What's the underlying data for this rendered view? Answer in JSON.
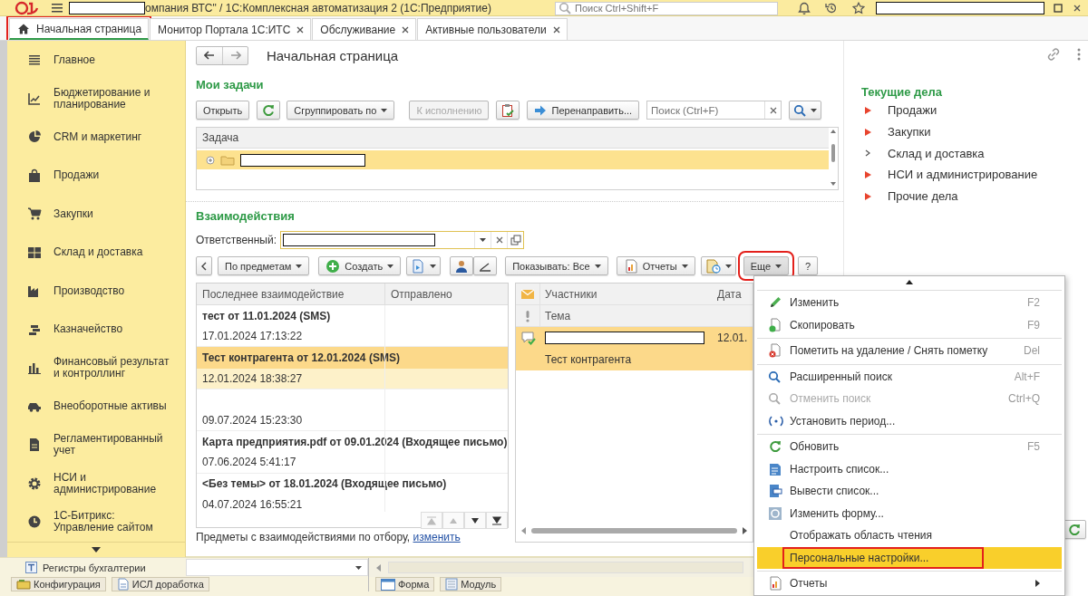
{
  "top_bar": {
    "title": "омпания ВТС\" / 1С:Комплексная автоматизация 2 (1С:Предприятие)",
    "search": {
      "placeholder": "Поиск Ctrl+Shift+F"
    }
  },
  "tabs": [
    {
      "label": "Начальная страница",
      "selected": true,
      "closable": false,
      "highlighted": true
    },
    {
      "label": "Монитор Портала 1С:ИТС",
      "selected": false,
      "closable": true,
      "highlighted": false
    },
    {
      "label": "Обслуживание",
      "selected": false,
      "closable": true,
      "highlighted": false
    },
    {
      "label": "Активные пользователи",
      "selected": false,
      "closable": true,
      "highlighted": false
    }
  ],
  "sidebar": {
    "items": [
      {
        "label": "Главное"
      },
      {
        "label": "Бюджетирование и планирование"
      },
      {
        "label": "CRM и маркетинг"
      },
      {
        "label": "Продажи"
      },
      {
        "label": "Закупки"
      },
      {
        "label": "Склад и доставка"
      },
      {
        "label": "Производство"
      },
      {
        "label": "Казначейство"
      },
      {
        "label": "Финансовый результат и контроллинг"
      },
      {
        "label": "Внеоборотные активы"
      },
      {
        "label": "Регламентированный учет"
      },
      {
        "label": "НСИ и администрирование"
      },
      {
        "label": "1С-Битрикс: Управление сайтом"
      }
    ]
  },
  "page": {
    "title": "Начальная страница"
  },
  "my_tasks": {
    "heading": "Мои задачи",
    "toolbar": [
      {
        "kind": "button",
        "label": "Открыть",
        "dropdown": false,
        "disabled": false
      },
      {
        "kind": "icon",
        "dropdown": false,
        "disabled": false
      },
      {
        "kind": "button",
        "label": "Сгруппировать по",
        "dropdown": true,
        "disabled": false
      },
      {
        "kind": "button",
        "label": "К исполнению",
        "dropdown": false,
        "disabled": true
      },
      {
        "kind": "icon",
        "dropdown": false,
        "disabled": false
      },
      {
        "kind": "button",
        "label": "Перенаправить...",
        "dropdown": false,
        "disabled": false
      },
      {
        "kind": "search",
        "placeholder": "Поиск (Ctrl+F)"
      },
      {
        "kind": "icon",
        "dropdown": true,
        "disabled": false
      }
    ],
    "table": {
      "columns": [
        "Задача"
      ],
      "rows": [
        {
          "selected": true
        }
      ]
    }
  },
  "interactions": {
    "heading": "Взаимодействия",
    "responsible": {
      "label": "Ответственный:"
    },
    "toolbar": [
      {
        "kind": "icon",
        "dropdown": false,
        "disabled": false,
        "highlighted": false
      },
      {
        "kind": "button",
        "label": "По предметам",
        "dropdown": true,
        "disabled": false,
        "highlighted": false
      },
      {
        "kind": "button",
        "label": "Создать",
        "dropdown": true,
        "disabled": false,
        "highlighted": false
      },
      {
        "kind": "icon",
        "dropdown": true,
        "disabled": false,
        "highlighted": false
      },
      {
        "kind": "icon",
        "dropdown": false,
        "disabled": false,
        "highlighted": false
      },
      {
        "kind": "icon",
        "dropdown": false,
        "disabled": false,
        "highlighted": false
      },
      {
        "kind": "button",
        "label": "Показывать: Все",
        "dropdown": true,
        "disabled": false,
        "highlighted": false
      },
      {
        "kind": "button",
        "label": "Отчеты",
        "dropdown": true,
        "disabled": false,
        "highlighted": false
      },
      {
        "kind": "icon",
        "dropdown": true,
        "disabled": false,
        "highlighted": false
      },
      {
        "kind": "button",
        "label": "Еще",
        "dropdown": true,
        "disabled": false,
        "highlighted": true
      },
      {
        "kind": "button",
        "label": "?",
        "dropdown": false,
        "disabled": false,
        "highlighted": false
      }
    ],
    "list": {
      "columns": [
        "Последнее взаимодействие",
        "Отправлено"
      ],
      "rows": [
        {
          "subject": "тест от 11.01.2024 (SMS)",
          "date": "17.01.2024 17:13:22",
          "selected": false
        },
        {
          "subject": "Тест контрагента от 12.01.2024 (SMS)",
          "date": "12.01.2024 18:38:27",
          "selected": true
        },
        {
          "date": "09.07.2024 15:23:30",
          "selected": false
        },
        {
          "subject": "Карта предприятия.pdf от 09.01.2024 (Входящее письмо)",
          "date": "07.06.2024 5:41:17",
          "selected": false
        },
        {
          "subject": "<Без темы> от 18.01.2024 (Входящее письмо)",
          "date": "04.07.2024 16:55:21",
          "selected": false
        }
      ],
      "navigation": [
        {
          "disabled": true
        },
        {
          "disabled": true
        },
        {
          "disabled": false
        },
        {
          "disabled": false
        }
      ]
    },
    "detail": {
      "columns": [
        "Участники",
        "Дата"
      ],
      "subcolumn": "Тема",
      "rows": [
        {
          "date": "12.01.",
          "subject": "Тест контрагента",
          "selected": true
        }
      ]
    },
    "footer": {
      "text": "Предметы с взаимодействиями по отбору,",
      "link": "изменить"
    }
  },
  "current_tasks": {
    "heading": "Текущие дела",
    "items": [
      {
        "label": "Продажи",
        "attention": true
      },
      {
        "label": "Закупки",
        "attention": true
      },
      {
        "label": "Склад и доставка",
        "attention": false
      },
      {
        "label": "НСИ и администрирование",
        "attention": true
      },
      {
        "label": "Прочие дела",
        "attention": true
      }
    ]
  },
  "menu": {
    "items": [
      {
        "kind": "item",
        "label": "Изменить",
        "shortcut": "F2",
        "disabled": false,
        "selected": false,
        "highlighted": false,
        "submenu": false
      },
      {
        "kind": "item",
        "label": "Скопировать",
        "shortcut": "F9",
        "disabled": false,
        "selected": false,
        "highlighted": false,
        "submenu": false
      },
      {
        "kind": "separator"
      },
      {
        "kind": "item",
        "label": "Пометить на удаление / Снять пометку",
        "shortcut": "Del",
        "disabled": false,
        "selected": false,
        "highlighted": false,
        "submenu": false
      },
      {
        "kind": "separator"
      },
      {
        "kind": "item",
        "label": "Расширенный поиск",
        "shortcut": "Alt+F",
        "disabled": false,
        "selected": false,
        "highlighted": false,
        "submenu": false
      },
      {
        "kind": "item",
        "label": "Отменить поиск",
        "shortcut": "Ctrl+Q",
        "disabled": true,
        "selected": false,
        "highlighted": false,
        "submenu": false
      },
      {
        "kind": "item",
        "label": "Установить период...",
        "disabled": false,
        "selected": false,
        "highlighted": false,
        "submenu": false
      },
      {
        "kind": "separator"
      },
      {
        "kind": "item",
        "label": "Обновить",
        "shortcut": "F5",
        "disabled": false,
        "selected": false,
        "highlighted": false,
        "submenu": false
      },
      {
        "kind": "item",
        "label": "Настроить список...",
        "disabled": false,
        "selected": false,
        "highlighted": false,
        "submenu": false
      },
      {
        "kind": "item",
        "label": "Вывести список...",
        "disabled": false,
        "selected": false,
        "highlighted": false,
        "submenu": false
      },
      {
        "kind": "item",
        "label": "Изменить форму...",
        "disabled": false,
        "selected": false,
        "highlighted": false,
        "submenu": false
      },
      {
        "kind": "item",
        "label": "Отображать область чтения",
        "disabled": false,
        "selected": false,
        "highlighted": false,
        "submenu": false
      },
      {
        "kind": "item",
        "label": "Персональные настройки...",
        "disabled": false,
        "selected": true,
        "highlighted": true,
        "submenu": false
      },
      {
        "kind": "separator"
      },
      {
        "kind": "item",
        "label": "Отчеты",
        "disabled": false,
        "selected": false,
        "highlighted": false,
        "submenu": true
      }
    ]
  },
  "designer": {
    "tree": [
      {
        "label": "Регистры бухгалтерии"
      }
    ],
    "tabs": [
      {
        "label": "Конфигурация"
      },
      {
        "label": "ИСЛ доработка"
      }
    ],
    "editor_tabs": [
      {
        "label": "Форма"
      },
      {
        "label": "Модуль"
      }
    ]
  }
}
